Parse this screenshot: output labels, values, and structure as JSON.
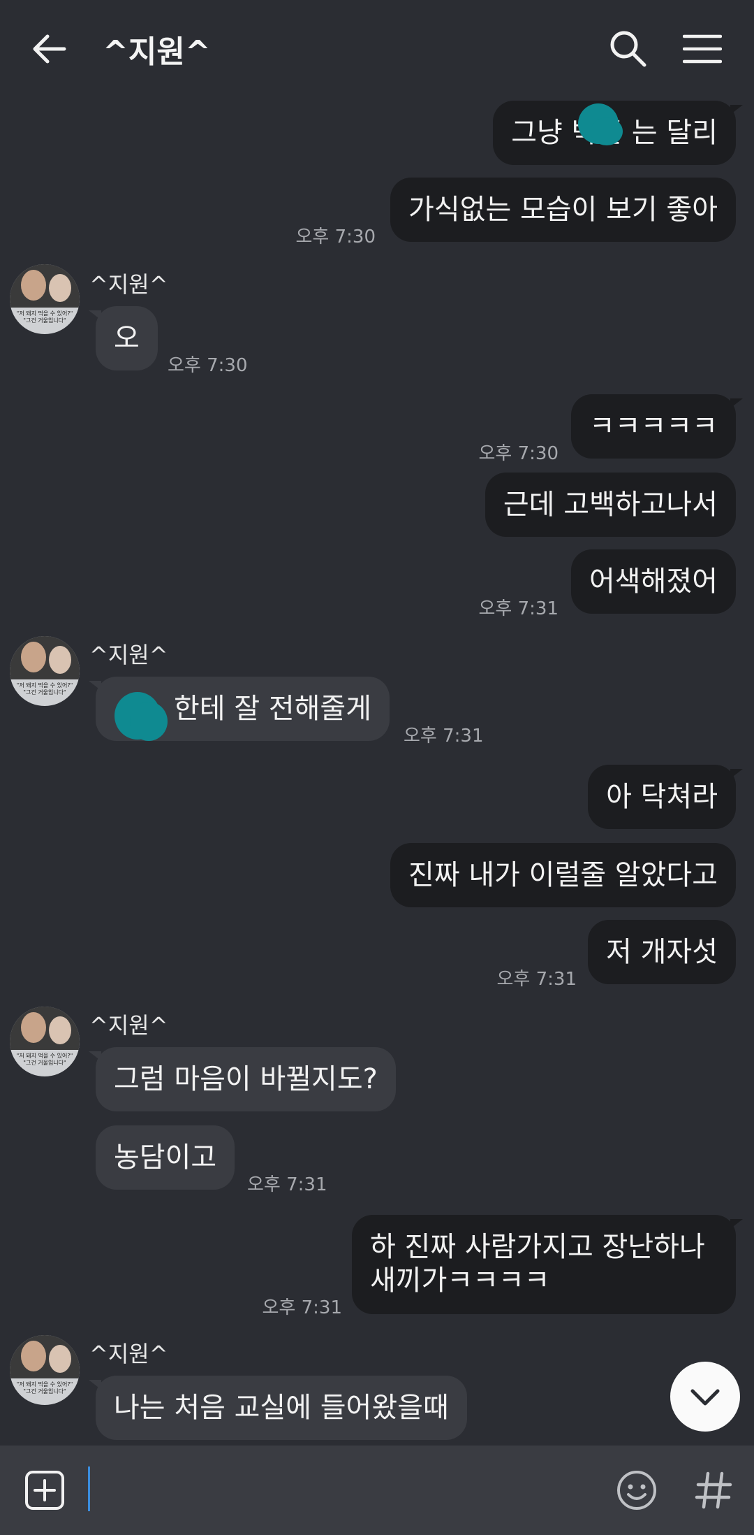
{
  "header": {
    "title": "^지원^",
    "back_icon": "arrow-left-icon",
    "search_icon": "search-icon",
    "menu_icon": "hamburger-menu-icon"
  },
  "contact": {
    "name": "^지원^",
    "avatar_caption_1": "\"저 돼지 먹을 수 있어?\"",
    "avatar_caption_2": "\"그건 거울입니다\""
  },
  "messages": [
    {
      "side": "me",
      "text": "그냥 박준 는 달리",
      "obscured": true
    },
    {
      "side": "me",
      "text": "가식없는 모습이 보기 좋아",
      "time": "오후 7:30"
    },
    {
      "side": "other",
      "text": "오",
      "time": "오후 7:30"
    },
    {
      "side": "me",
      "text": "ㅋㅋㅋㅋㅋ",
      "time": "오후 7:30"
    },
    {
      "side": "me",
      "text": "근데 고백하고나서"
    },
    {
      "side": "me",
      "text": "어색해졌어",
      "time": "오후 7:31"
    },
    {
      "side": "other",
      "text": "한테 잘 전해줄게",
      "time": "오후 7:31",
      "obscured": true
    },
    {
      "side": "me",
      "text": "아 닥쳐라"
    },
    {
      "side": "me",
      "text": "진짜 내가 이럴줄 알았다고"
    },
    {
      "side": "me",
      "text": "저 개자섯",
      "time": "오후 7:31"
    },
    {
      "side": "other",
      "text": "그럼 마음이 바뀔지도?"
    },
    {
      "side": "other",
      "text": "농담이고",
      "time": "오후 7:31"
    },
    {
      "side": "me",
      "text": "하 진짜 사람가지고 장난하나 새끼가ㅋㅋㅋㅋ",
      "time": "오후 7:31"
    },
    {
      "side": "other",
      "text": "나는 처음 교실에 들어왔을때"
    }
  ],
  "colors": {
    "background": "#2b2d33",
    "my_bubble": "#1c1d20",
    "their_bubble": "#3a3c42",
    "redaction": "#0f8a91"
  },
  "input": {
    "value": "",
    "add_icon": "plus-square-icon",
    "emoji_icon": "smiley-icon",
    "hashtag_icon": "hashtag-icon"
  },
  "scroll_button_icon": "chevron-down-icon"
}
